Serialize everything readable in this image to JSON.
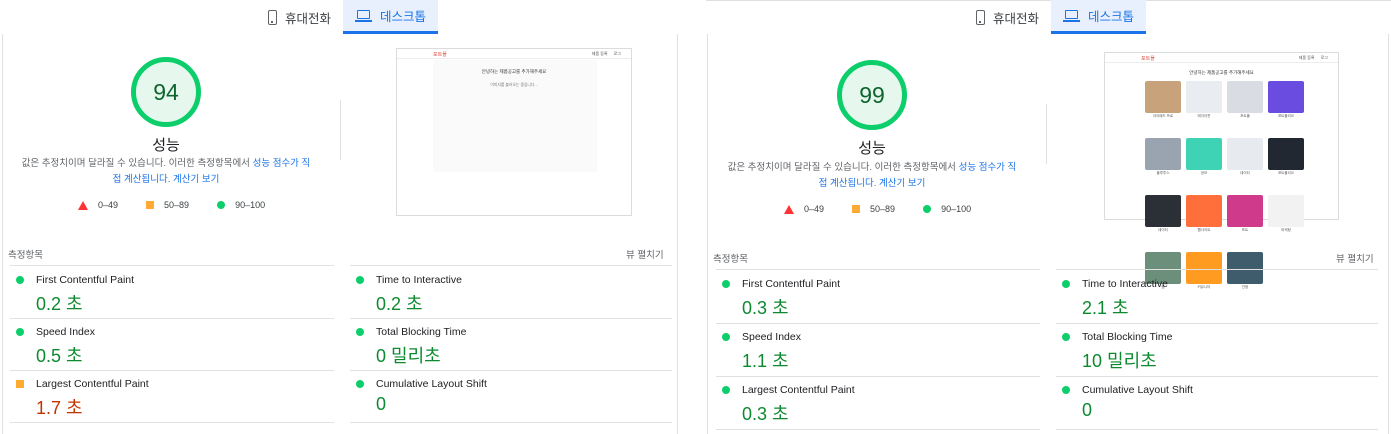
{
  "tabs": {
    "mobile": "휴대전화",
    "desktop": "데스크톱"
  },
  "common": {
    "perf_label": "성능",
    "desc_plain": "값은 추정치이며 달라질 수 있습니다. 이러한 측정항목에서 ",
    "desc_link1a": "성능 점수가 직",
    "desc_link1b": "접 계산됩니다",
    "desc_dot": ". ",
    "desc_link2": "계산기 보기",
    "legend": {
      "fail": "0–49",
      "average": "50–89",
      "pass": "90–100"
    },
    "section_label": "측정항목",
    "expand_label": "뷰 펼치기",
    "metric_names": {
      "fcp": "First Contentful Paint",
      "si": "Speed Index",
      "lcp": "Largest Contentful Paint",
      "tti": "Time to Interactive",
      "tbt": "Total Blocking Time",
      "cls": "Cumulative Layout Shift"
    }
  },
  "left": {
    "score": "94",
    "metrics": {
      "fcp": "0.2 초",
      "si": "0.5 초",
      "lcp": "1.7 초",
      "tti": "0.2 초",
      "tbt": "0 밀리초",
      "cls": "0"
    },
    "lcp_status": "average"
  },
  "right": {
    "score": "99",
    "metrics": {
      "fcp": "0.3 초",
      "si": "1.1 초",
      "lcp": "0.3 초",
      "tti": "2.1 초",
      "tbt": "10 밀리초",
      "cls": "0"
    },
    "lcp_status": "pass"
  },
  "screenshot": {
    "logo": "포트폴",
    "title": "안녕하는 제품공고를 추가해주세요",
    "sub": "이미지를 불러오는 중입니다...",
    "nav": [
      "제품 등록",
      "로그"
    ],
    "thumb_colors": [
      "#c8a27a",
      "#e9edf2",
      "#d9dde3",
      "#6a4de0",
      "#9aa4b0",
      "#3fd3b6",
      "#e7eaee",
      "#222831",
      "#2b2f36",
      "#ff6f3c",
      "#d03a8a",
      "#f2f2f2",
      "#6b8f7a",
      "#ff9b21",
      "#3e5c6b"
    ],
    "thumb_caps": [
      "아이패드 프로",
      "레이아웃",
      "포트폴",
      "포트폴리오",
      "블루투스",
      "공모",
      "데이터",
      "포트폴리오",
      "데이터",
      "웹사이트",
      "포트",
      "마케팅",
      "팀",
      "커뮤니티",
      "관광"
    ]
  },
  "colors": {
    "pass": "#0cce6b",
    "average": "#ffaa33",
    "fail": "#ff3333",
    "link": "#1a73e8"
  }
}
